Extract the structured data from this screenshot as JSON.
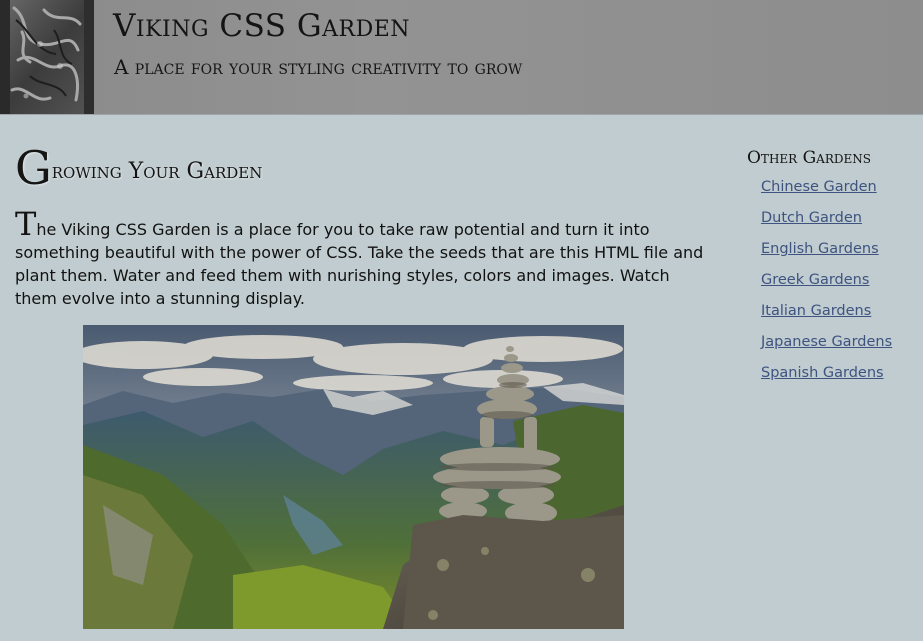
{
  "header": {
    "title": "Viking CSS Garden",
    "tagline": "A place for your styling creativity to grow"
  },
  "main": {
    "heading_cap": "G",
    "heading_rest": "rowing Your Garden",
    "intro_cap": "T",
    "intro_rest": "he Viking CSS Garden is a place for you to take raw potential and turn it into something beautiful with the power of CSS. Take the seeds that are this HTML file and plant them. Water and feed them with nurishing styles, colors and images. Watch them evolve into a stunning display."
  },
  "sidebar": {
    "title": "Other Gardens",
    "links": [
      {
        "label": "Chinese Garden"
      },
      {
        "label": "Dutch Garden"
      },
      {
        "label": "English Gardens"
      },
      {
        "label": "Greek Gardens"
      },
      {
        "label": "Italian Gardens"
      },
      {
        "label": "Japanese Gardens"
      },
      {
        "label": "Spanish Gardens"
      }
    ]
  },
  "colors": {
    "page_background": "#c0cccf",
    "header_background": "#8d8d8d",
    "link": "#3e5380"
  }
}
